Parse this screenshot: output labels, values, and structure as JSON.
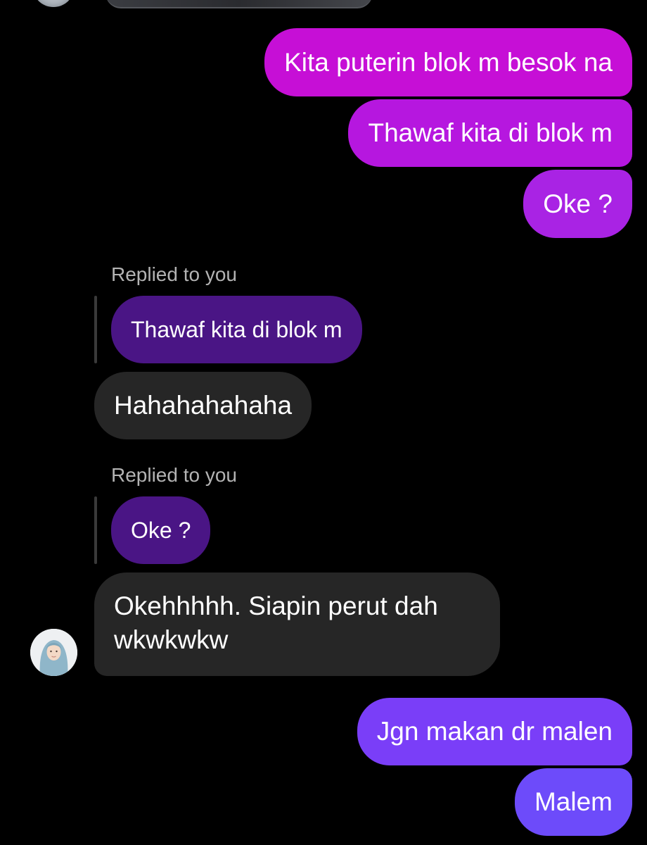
{
  "conversation": {
    "outgoing_top": [
      "Kita puterin blok m besok na",
      "Thawaf kita di blok m",
      "Oke ?"
    ],
    "reply_1": {
      "label": "Replied to you",
      "quoted": "Thawaf kita di blok m",
      "message": "Hahahahahaha"
    },
    "reply_2": {
      "label": "Replied to you",
      "quoted": "Oke ?",
      "message": "Okehhhhh. Siapin perut dah wkwkwkw"
    },
    "outgoing_bottom": [
      "Jgn makan dr malen",
      "Malem"
    ]
  },
  "colors": {
    "background": "#000000",
    "outgoing_gradient": [
      "#c60fd6",
      "#b617df",
      "#a923e4",
      "#7a3ef8",
      "#6d4bfa"
    ],
    "incoming_bubble": "#262626",
    "quoted_bubble": "#4a1585",
    "secondary_text": "#b3b3b3"
  },
  "icons": {
    "contact_avatar": "avatar-icon"
  }
}
